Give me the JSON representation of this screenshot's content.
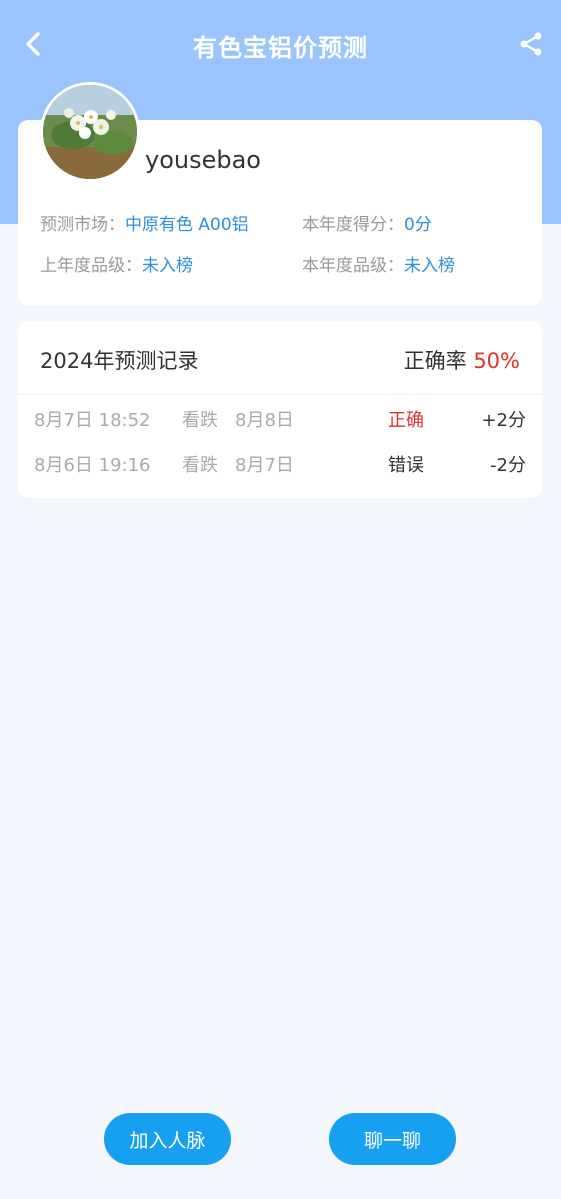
{
  "nav": {
    "title": "有色宝铝价预测"
  },
  "profile": {
    "username": "yousebao",
    "market_label": "预测市场：",
    "market_value": "中原有色 A00铝",
    "score_label": "本年度得分：",
    "score_value": "0分",
    "last_grade_label": "上年度品级：",
    "last_grade_value": "未入榜",
    "this_grade_label": "本年度品级：",
    "this_grade_value": "未入榜"
  },
  "records": {
    "title": "2024年预测记录",
    "rate_label": "正确率",
    "rate_value": "50%",
    "rows": [
      {
        "time": "8月7日 18:52",
        "direction": "看跌",
        "date": "8月8日",
        "result": "正确",
        "score": "+2分"
      },
      {
        "time": "8月6日 19:16",
        "direction": "看跌",
        "date": "8月7日",
        "result": "错误",
        "score": "-2分"
      }
    ]
  },
  "actions": {
    "join": "加入人脉",
    "chat": "聊一聊"
  },
  "colors": {
    "accent": "#18a0f0",
    "header": "#9ac4fb",
    "link": "#2d8fe0",
    "correct": "#e03131"
  }
}
